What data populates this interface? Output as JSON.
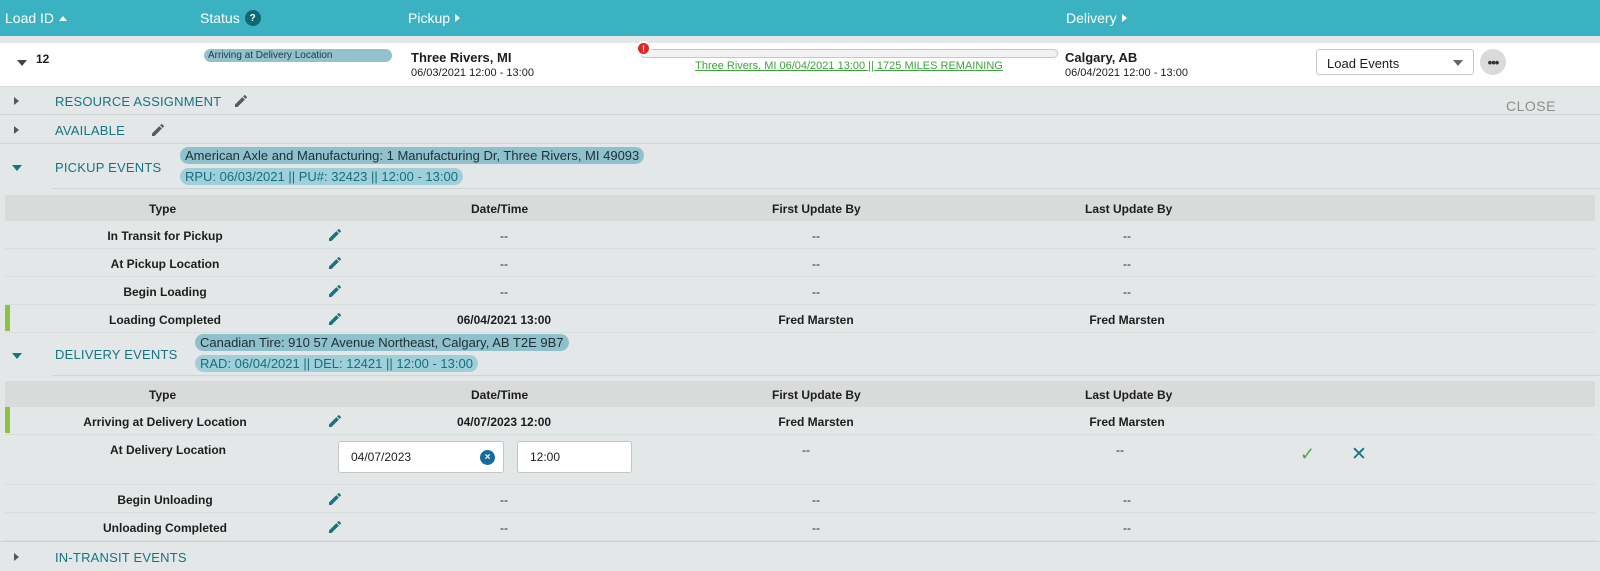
{
  "header": {
    "load_id": "Load ID",
    "status": "Status",
    "status_help": "?",
    "pickup": "Pickup",
    "delivery": "Delivery"
  },
  "load": {
    "id": "12",
    "status": "Arriving at Delivery Location",
    "pickup_city": "Three Rivers, MI",
    "pickup_time": "06/03/2021 12:00 - 13:00",
    "delivery_city": "Calgary, AB",
    "delivery_time": "06/04/2021 12:00 - 13:00",
    "progress_label": "Three Rivers, MI 06/04/2021 13:00 || 1725 MILES REMAINING",
    "alert": "!",
    "events_select": "Load Events",
    "more": "•••"
  },
  "sections": {
    "resource": "RESOURCE ASSIGNMENT",
    "available": "AVAILABLE",
    "close": "CLOSE",
    "pickup_events": "PICKUP EVENTS",
    "pickup_address": "American Axle and Manufacturing: 1 Manufacturing Dr, Three Rivers, MI 49093",
    "pickup_details": "RPU: 06/03/2021 || PU#: 32423 || 12:00 - 13:00",
    "delivery_events": "DELIVERY EVENTS",
    "delivery_address": "Canadian Tire: 910 57 Avenue Northeast, Calgary, AB T2E 9B7",
    "delivery_details": "RAD: 06/04/2021 || DEL: 12421 || 12:00 - 13:00",
    "in_transit": "IN-TRANSIT EVENTS"
  },
  "table_headers": {
    "type": "Type",
    "datetime": "Date/Time",
    "first": "First Update By",
    "last": "Last Update By"
  },
  "pickup_rows": [
    {
      "type": "In Transit for Pickup",
      "datetime": "--",
      "first": "--",
      "last": "--"
    },
    {
      "type": "At Pickup Location",
      "datetime": "--",
      "first": "--",
      "last": "--"
    },
    {
      "type": "Begin Loading",
      "datetime": "--",
      "first": "--",
      "last": "--"
    },
    {
      "type": "Loading Completed",
      "datetime": "06/04/2021 13:00",
      "first": "Fred Marsten",
      "last": "Fred Marsten"
    }
  ],
  "delivery_rows": [
    {
      "type": "Arriving at Delivery Location",
      "datetime": "04/07/2023 12:00",
      "first": "Fred Marsten",
      "last": "Fred Marsten"
    },
    {
      "type": "At Delivery Location",
      "date_input": "04/07/2023",
      "time_input": "12:00",
      "first": "--",
      "last": "--"
    },
    {
      "type": "Begin Unloading",
      "datetime": "--",
      "first": "--",
      "last": "--"
    },
    {
      "type": "Unloading Completed",
      "datetime": "--",
      "first": "--",
      "last": "--"
    }
  ],
  "icons": {
    "edit": "pencil-icon",
    "confirm": "✓",
    "cancel": "✕",
    "clear": "×"
  }
}
